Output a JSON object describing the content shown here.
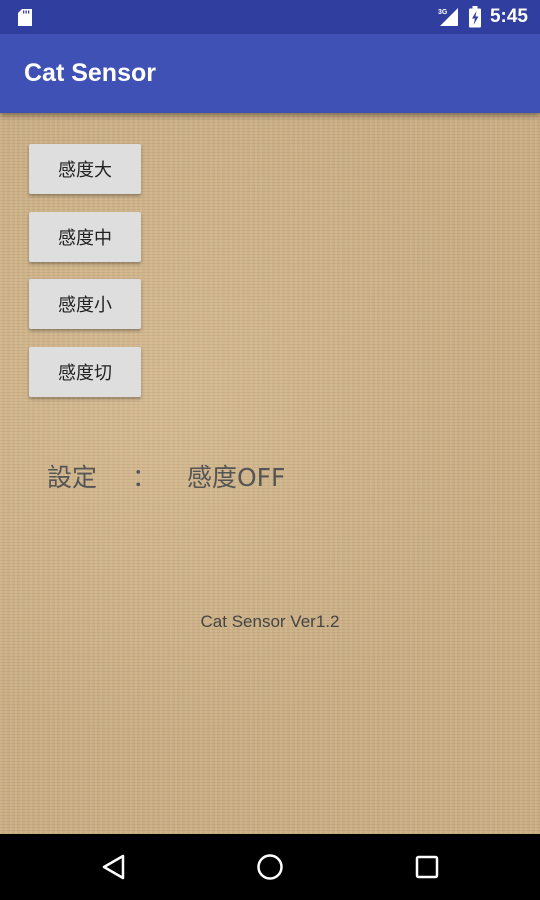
{
  "status_bar": {
    "time": "5:45",
    "network": "3G",
    "icons": [
      "sd-card-icon",
      "signal-icon",
      "battery-icon"
    ]
  },
  "app_bar": {
    "title": "Cat Sensor",
    "color": "#3f51b5"
  },
  "buttons": [
    {
      "label": "感度大"
    },
    {
      "label": "感度中"
    },
    {
      "label": "感度小"
    },
    {
      "label": "感度切"
    }
  ],
  "setting": {
    "label": "設定",
    "separator": "：",
    "value": "感度OFF"
  },
  "footer": {
    "version": "Cat Sensor Ver1.2"
  },
  "nav_bar": {
    "icons": [
      "back-icon",
      "home-icon",
      "recent-apps-icon"
    ]
  }
}
